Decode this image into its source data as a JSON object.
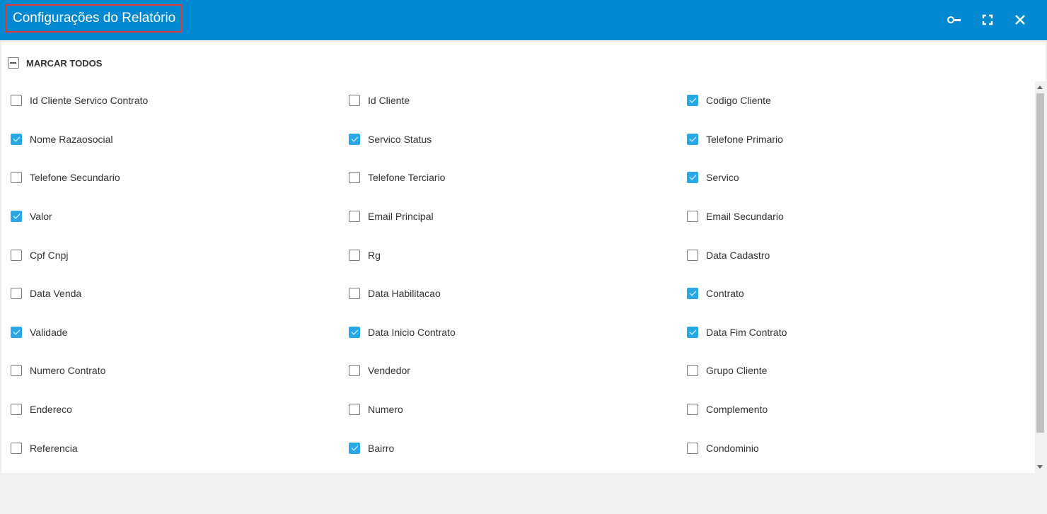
{
  "dialog": {
    "title": "Configurações do Relatório",
    "header_icons": [
      "key-icon",
      "fullscreen-icon",
      "close-icon"
    ]
  },
  "select_all": {
    "label": "MARCAR TODOS",
    "state": "indeterminate"
  },
  "fields": [
    {
      "label": "Id Cliente Servico Contrato",
      "checked": false
    },
    {
      "label": "Id Cliente",
      "checked": false
    },
    {
      "label": "Codigo Cliente",
      "checked": true
    },
    {
      "label": "Nome Razaosocial",
      "checked": true
    },
    {
      "label": "Servico Status",
      "checked": true
    },
    {
      "label": "Telefone Primario",
      "checked": true
    },
    {
      "label": "Telefone Secundario",
      "checked": false
    },
    {
      "label": "Telefone Terciario",
      "checked": false
    },
    {
      "label": "Servico",
      "checked": true
    },
    {
      "label": "Valor",
      "checked": true
    },
    {
      "label": "Email Principal",
      "checked": false
    },
    {
      "label": "Email Secundario",
      "checked": false
    },
    {
      "label": "Cpf Cnpj",
      "checked": false
    },
    {
      "label": "Rg",
      "checked": false
    },
    {
      "label": "Data Cadastro",
      "checked": false
    },
    {
      "label": "Data Venda",
      "checked": false
    },
    {
      "label": "Data Habilitacao",
      "checked": false
    },
    {
      "label": "Contrato",
      "checked": true
    },
    {
      "label": "Validade",
      "checked": true
    },
    {
      "label": "Data Inicio Contrato",
      "checked": true
    },
    {
      "label": "Data Fim Contrato",
      "checked": true
    },
    {
      "label": "Numero Contrato",
      "checked": false
    },
    {
      "label": "Vendedor",
      "checked": false
    },
    {
      "label": "Grupo Cliente",
      "checked": false
    },
    {
      "label": "Endereco",
      "checked": false
    },
    {
      "label": "Numero",
      "checked": false
    },
    {
      "label": "Complemento",
      "checked": false
    },
    {
      "label": "Referencia",
      "checked": false
    },
    {
      "label": "Bairro",
      "checked": true
    },
    {
      "label": "Condominio",
      "checked": false
    }
  ],
  "colors": {
    "header": "#0288d1",
    "checkbox_checked": "#29a8e8",
    "title_highlight": "#e53935"
  }
}
